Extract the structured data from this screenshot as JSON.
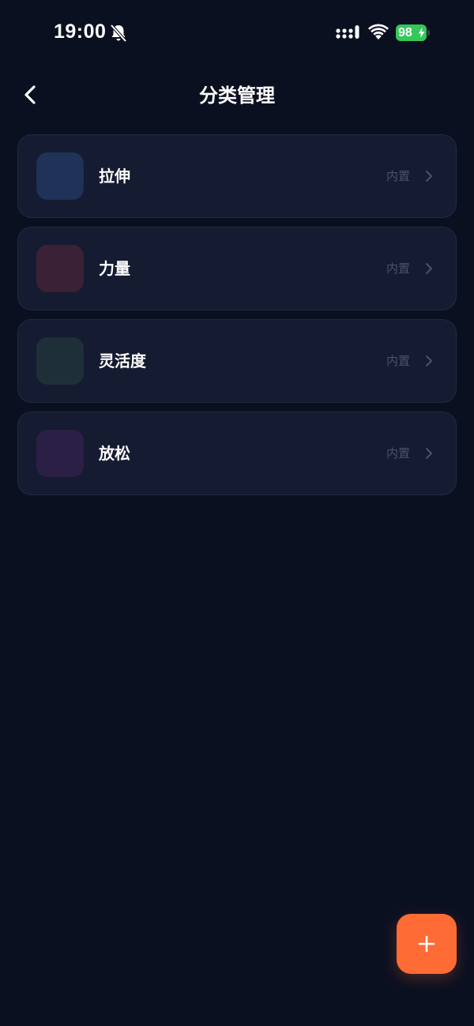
{
  "status_bar": {
    "time": "19:00",
    "battery_level": "98",
    "icons": [
      "bell-slash-icon",
      "cellular-signal-icon",
      "wifi-icon",
      "battery-charging-icon"
    ],
    "battery_color": "#34c759"
  },
  "nav": {
    "title": "分类管理",
    "back_icon": "chevron-left-icon"
  },
  "categories": [
    {
      "name": "拉伸",
      "tag": "内置",
      "icon_color": "#1f3257"
    },
    {
      "name": "力量",
      "tag": "内置",
      "icon_color": "#3a2136"
    },
    {
      "name": "灵活度",
      "tag": "内置",
      "icon_color": "#1f2f38"
    },
    {
      "name": "放松",
      "tag": "内置",
      "icon_color": "#2b1f45"
    }
  ],
  "fab": {
    "icon": "plus-icon",
    "color": "#ff6b35"
  },
  "colors": {
    "background": "#0b1020",
    "card": "#151b30",
    "accent": "#ff6b35",
    "muted_text": "#4b5268"
  }
}
